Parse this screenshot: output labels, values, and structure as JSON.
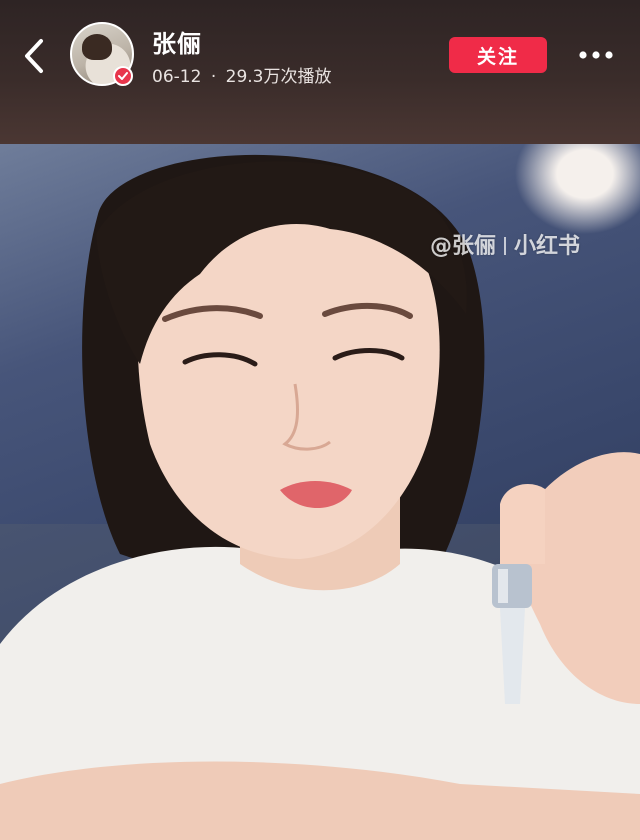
{
  "header": {
    "back_icon": "chevron-left-icon",
    "author_name": "张俪",
    "post_date": "06-12",
    "separator": "·",
    "play_count": "29.3万次播放",
    "follow_label": "关注",
    "more_icon": "more-dots-icon",
    "verified_icon": "verified-check-icon"
  },
  "video": {
    "watermark_handle": "@张俪",
    "watermark_brand": "小红书"
  },
  "colors": {
    "follow_button": "#f02b48",
    "header_background": "#2e2424",
    "verified_badge": "#e8364c"
  }
}
